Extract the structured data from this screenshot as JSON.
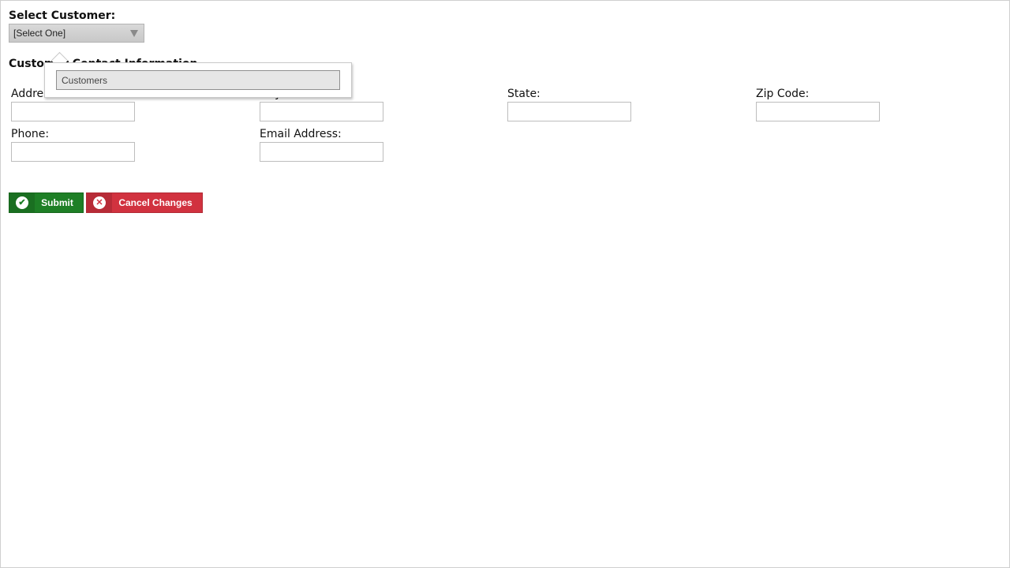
{
  "select_customer": {
    "label": "Select Customer:",
    "value": "[Select One]"
  },
  "section": {
    "title": "Customer Contact Information"
  },
  "fields": {
    "address": {
      "label": "Address:",
      "value": ""
    },
    "city": {
      "label": "City:",
      "value": ""
    },
    "state": {
      "label": "State:",
      "value": ""
    },
    "zip": {
      "label": "Zip Code:",
      "value": ""
    },
    "phone": {
      "label": "Phone:",
      "value": ""
    },
    "email": {
      "label": "Email Address:",
      "value": ""
    }
  },
  "buttons": {
    "submit": {
      "label": "Submit",
      "icon": "check-circle-icon",
      "color": "#1e7f26"
    },
    "cancel": {
      "label": "Cancel Changes",
      "icon": "x-circle-icon",
      "color": "#d1323f"
    }
  },
  "dropdown_popup": {
    "items": [
      "Customers"
    ]
  }
}
